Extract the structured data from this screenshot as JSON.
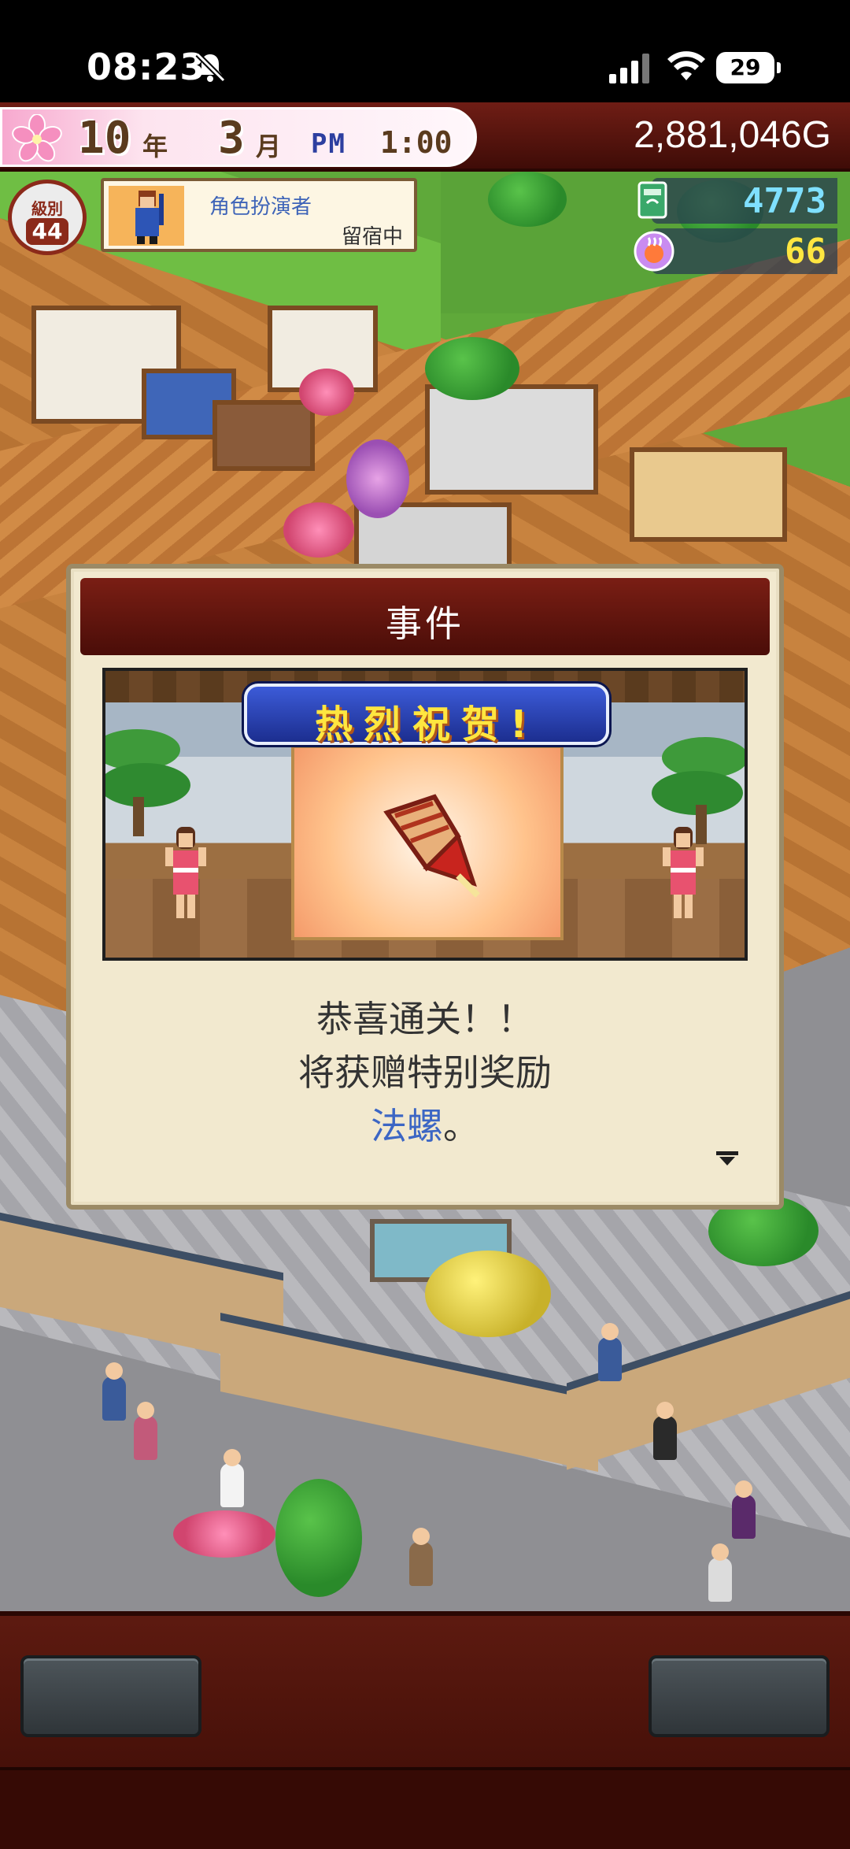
{
  "status_bar": {
    "time": "08:23",
    "battery": "29",
    "icons": [
      "bell-slash-icon",
      "cellular-signal-icon",
      "wifi-icon",
      "battery-icon"
    ]
  },
  "hud": {
    "year_value": "10",
    "year_unit": "年",
    "month_value": "3",
    "month_unit": "月",
    "ampm": "PM",
    "time": "1:00",
    "gold": "2,881,046G"
  },
  "character": {
    "level_label": "級別",
    "level_value": "44",
    "name": "角色扮演者",
    "status": "留宿中"
  },
  "resources": {
    "research_points": "4773",
    "onsen_points": "66",
    "research_color": "#7fe0ff",
    "onsen_color": "#ffe640"
  },
  "event_dialog": {
    "title": "事件",
    "banner": "热烈祝贺!",
    "line1": "恭喜通关！！",
    "line2": "将获赠特别奖励",
    "item": "法螺",
    "item_suffix": "。",
    "reward_icon": "conch-shell-icon"
  },
  "bottom_bar": {
    "buttons": [
      "",
      ""
    ]
  }
}
